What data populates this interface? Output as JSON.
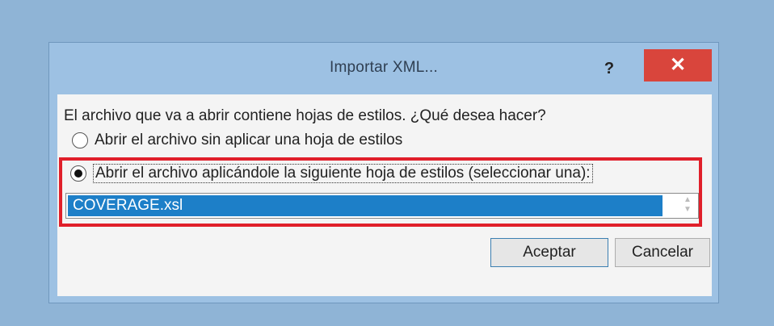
{
  "dialog": {
    "title": "Importar XML...",
    "help_label": "?",
    "close_label": "✕",
    "prompt": "El archivo que va a abrir contiene hojas de estilos. ¿Qué desea hacer?",
    "option1_label": "Abrir el archivo sin aplicar una hoja de estilos",
    "option2_label": "Abrir el archivo aplicándole la siguiente hoja de estilos (seleccionar una):",
    "option1_checked": false,
    "option2_checked": true,
    "stylesheet_selected": "COVERAGE.xsl",
    "ok_label": "Aceptar",
    "cancel_label": "Cancelar"
  },
  "colors": {
    "accent_red": "#e01f2a",
    "selection_blue": "#1d7fc8",
    "close_red": "#d9453c"
  }
}
